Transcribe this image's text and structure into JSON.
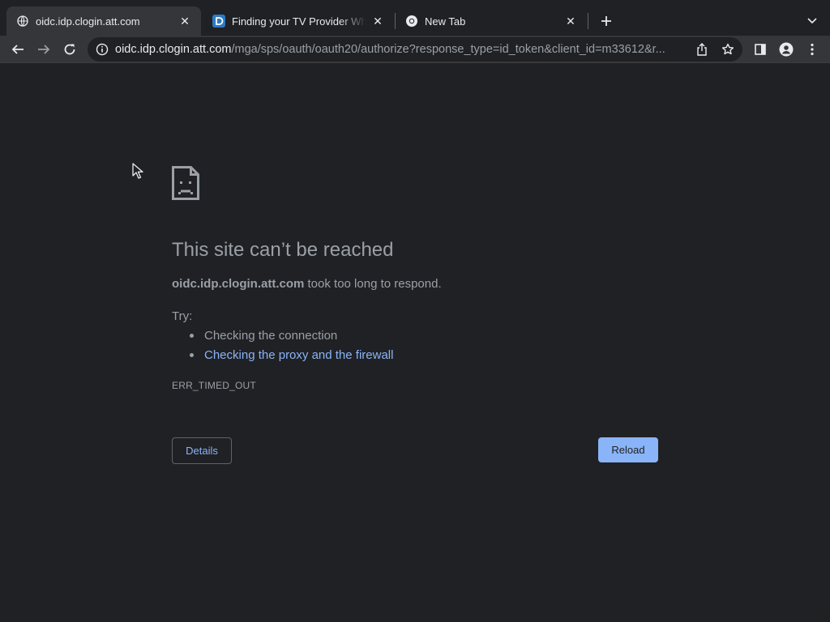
{
  "tabs": [
    {
      "title": "oidc.idp.clogin.att.com",
      "active": true,
      "favicon": "globe-icon"
    },
    {
      "title": "Finding your TV Provider When",
      "active": false,
      "favicon": "directv-icon"
    },
    {
      "title": "New Tab",
      "active": false,
      "favicon": "chrome-icon"
    }
  ],
  "toolbar": {
    "url_host": "oidc.idp.clogin.att.com",
    "url_path": "/mga/sps/oauth/oauth20/authorize?response_type=id_token&client_id=m33612&r..."
  },
  "error": {
    "headline": "This site can’t be reached",
    "host": "oidc.idp.clogin.att.com",
    "message": " took too long to respond.",
    "try_label": "Try:",
    "suggestions": [
      "Checking the connection",
      "Checking the proxy and the firewall"
    ],
    "code": "ERR_TIMED_OUT",
    "details_label": "Details",
    "reload_label": "Reload"
  },
  "colors": {
    "background": "#202124",
    "toolbar": "#35363a",
    "link": "#8ab4f8",
    "text": "#9aa0a6"
  }
}
